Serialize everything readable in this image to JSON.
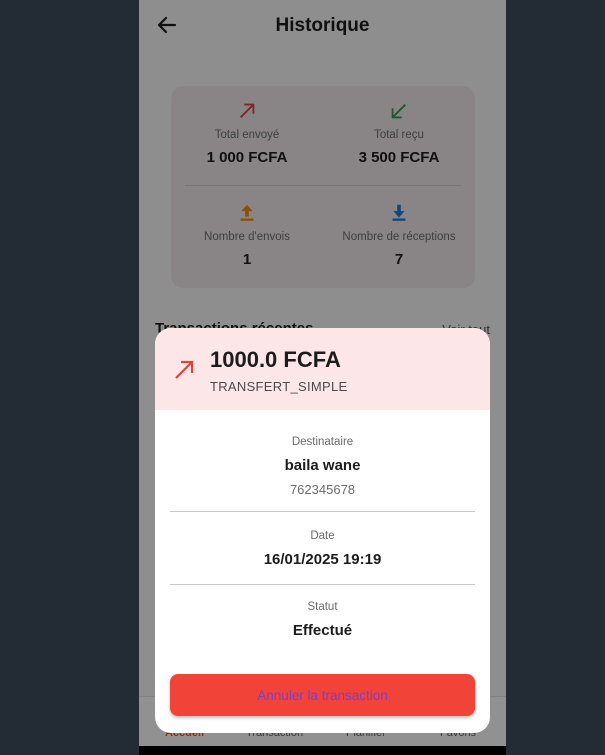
{
  "header": {
    "title": "Historique"
  },
  "stats": {
    "sent": {
      "label": "Total envoyé",
      "value": "1 000 FCFA",
      "icon": "arrow-up-right-icon"
    },
    "received": {
      "label": "Total reçu",
      "value": "3 500 FCFA",
      "icon": "arrow-down-left-icon"
    },
    "sends_count": {
      "label": "Nombre d'envois",
      "value": "1",
      "icon": "upload-icon"
    },
    "receptions_count": {
      "label": "Nombre de réceptions",
      "value": "7",
      "icon": "download-icon"
    }
  },
  "recent": {
    "title": "Transactions récentes",
    "link": "Voir tout"
  },
  "nav": {
    "items": [
      "Accueil",
      "Transaction",
      "Planifier",
      "Favoris"
    ],
    "active": "Accueil"
  },
  "dialog": {
    "amount": "1000.0 FCFA",
    "type": "TRANSFERT_SIMPLE",
    "recipient_label": "Destinataire",
    "recipient_name": "baila wane",
    "recipient_phone": "762345678",
    "date_label": "Date",
    "date_value": "16/01/2025 19:19",
    "status_label": "Statut",
    "status_value": "Effectué",
    "cancel_label": "Annuler la transaction"
  },
  "colors": {
    "sent_arrow": "#d9453b",
    "received_arrow": "#3a9a44",
    "upload": "#ef8a00",
    "download": "#1e78d6",
    "cancel_bg": "#f14337",
    "cancel_text": "#7a3fd0"
  }
}
